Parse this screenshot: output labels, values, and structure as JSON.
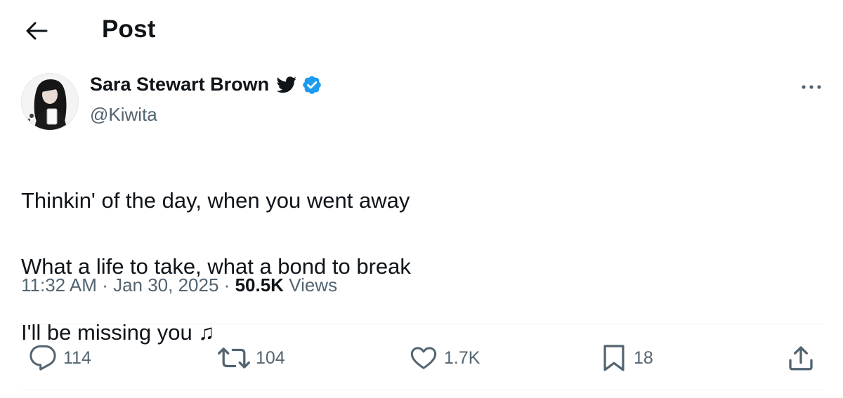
{
  "header": {
    "title": "Post",
    "back_icon": "arrow-left-icon"
  },
  "author": {
    "display_name": "Sara Stewart Brown",
    "handle": "@Kiwita",
    "badge_icons": [
      "bird-icon",
      "verified-badge-icon"
    ],
    "verified_color": "#1d9bf0"
  },
  "tweet": {
    "lines": [
      "Thinkin' of the day, when you went away",
      "What a life to take, what a bond to break",
      "I'll be missing you ♫"
    ]
  },
  "meta": {
    "time": "11:32 AM",
    "separator": "·",
    "date": "Jan 30, 2025",
    "views_count": "50.5K",
    "views_label": "Views"
  },
  "actions": {
    "reply_count": "114",
    "repost_count": "104",
    "like_count": "1.7K",
    "bookmark_count": "18"
  },
  "colors": {
    "text": "#0f1419",
    "secondary": "#536471",
    "accent": "#1d9bf0",
    "divider": "#eff3f4"
  }
}
